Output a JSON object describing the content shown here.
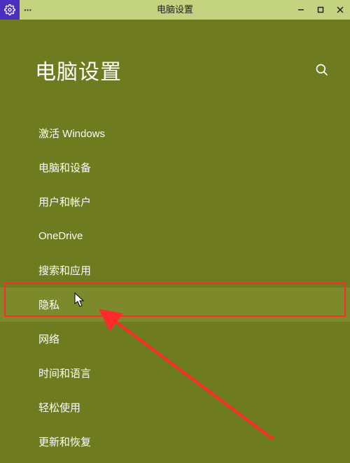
{
  "window": {
    "title": "电脑设置",
    "ellipsis": "···"
  },
  "page": {
    "title": "电脑设置"
  },
  "nav": {
    "items": [
      {
        "label": "激活 Windows"
      },
      {
        "label": "电脑和设备"
      },
      {
        "label": "用户和帐户"
      },
      {
        "label": "OneDrive"
      },
      {
        "label": "搜索和应用"
      },
      {
        "label": "隐私"
      },
      {
        "label": "网络"
      },
      {
        "label": "时间和语言"
      },
      {
        "label": "轻松使用"
      },
      {
        "label": "更新和恢复"
      }
    ]
  },
  "annotation": {
    "highlighted_index": 5
  }
}
